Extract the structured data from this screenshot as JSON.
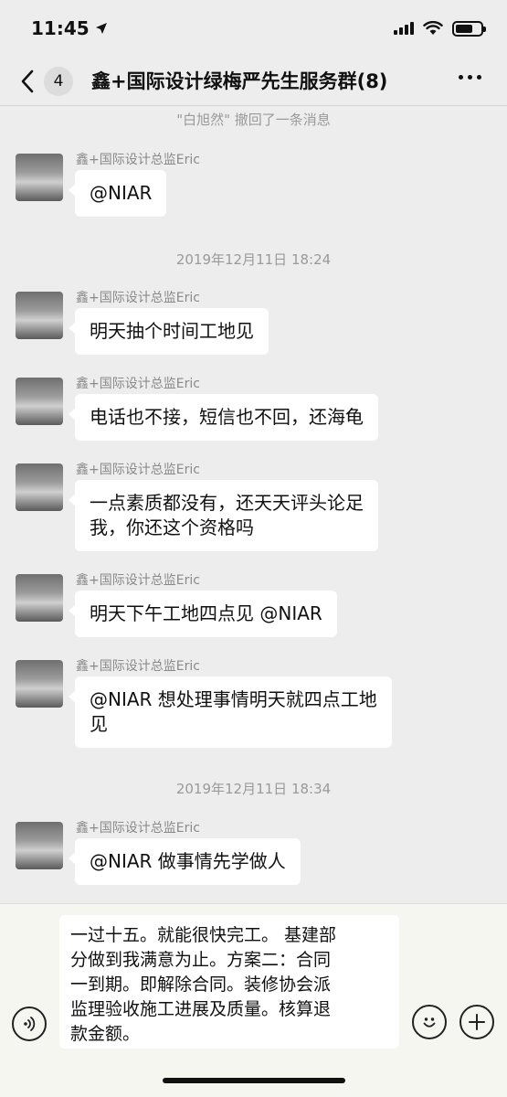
{
  "status_bar": {
    "time": "11:45",
    "location_icon": "location-arrow-icon",
    "signal_icon": "signal-bars-icon",
    "wifi_icon": "wifi-icon",
    "battery_icon": "battery-icon",
    "battery_level": 0.7
  },
  "nav": {
    "back_icon": "chevron-left-icon",
    "unread_count": "4",
    "title": "鑫+国际设计绿梅严先生服务群(8)",
    "more_icon": "more-dots-icon"
  },
  "chat": {
    "recall_notice": "\"白旭然\" 撤回了一条消息",
    "timestamps": [
      "2019年12月11日 18:24",
      "2019年12月11日 18:34"
    ],
    "messages": [
      {
        "sender": "鑫+国际设计总监Eric",
        "lines": [
          "@NIAR"
        ]
      },
      {
        "sender": "鑫+国际设计总监Eric",
        "lines": [
          "明天抽个时间工地见"
        ]
      },
      {
        "sender": "鑫+国际设计总监Eric",
        "lines": [
          "电话也不接，短信也不回，还海龟"
        ]
      },
      {
        "sender": "鑫+国际设计总监Eric",
        "lines": [
          "一点素质都没有，还天天评头论足",
          "我，你还这个资格吗"
        ]
      },
      {
        "sender": "鑫+国际设计总监Eric",
        "lines": [
          "明天下午工地四点见 @NIAR"
        ]
      },
      {
        "sender": "鑫+国际设计总监Eric",
        "lines": [
          "@NIAR 想处理事情明天就四点工地",
          "见"
        ]
      },
      {
        "sender": "鑫+国际设计总监Eric",
        "lines": [
          "@NIAR 做事情先学做人"
        ]
      }
    ]
  },
  "input": {
    "draft_lines": [
      "一过十五。就能很快完工。 基建部",
      "分做到我满意为止。方案二：合同",
      "一到期。即解除合同。装修协会派",
      "监理验收施工进展及质量。核算退",
      "款金额。"
    ],
    "voice_icon": "voice-input-icon",
    "emoji_icon": "emoji-icon",
    "plus_icon": "plus-icon"
  }
}
